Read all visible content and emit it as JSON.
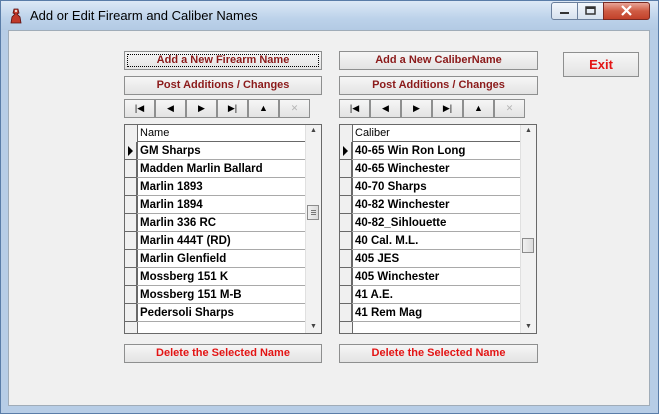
{
  "window": {
    "title": "Add or Edit Firearm and Caliber Names",
    "minimize_glyph": "▁",
    "maximize_glyph": "□",
    "close_glyph": "✕"
  },
  "left": {
    "add_label": "Add a New Firearm Name",
    "post_label": "Post Additions / Changes",
    "delete_label": "Delete the Selected Name",
    "column_header": "Name",
    "rows": [
      "GM Sharps",
      "Madden Marlin Ballard",
      "Marlin 1893",
      "Marlin 1894",
      "Marlin 336 RC",
      "Marlin 444T (RD)",
      "Marlin Glenfield",
      "Mossberg 151 K",
      "Mossberg 151 M-B",
      "Pedersoli Sharps"
    ],
    "current_row": 0,
    "scroll_fraction": 0.4
  },
  "right": {
    "add_label": "Add a New CaliberName",
    "post_label": "Post Additions / Changes",
    "delete_label": "Delete the Selected Name",
    "column_header": "Caliber",
    "rows": [
      "40-65 Win Ron Long",
      "40-65 Winchester",
      "40-70 Sharps",
      "40-82 Winchester",
      "40-82_Sihlouette",
      "40 Cal. M.L.",
      "405 JES",
      "405 Winchester",
      "41 A.E.",
      "41 Rem Mag"
    ],
    "current_row": 0,
    "scroll_fraction": 0.6
  },
  "nav_buttons": [
    {
      "name": "first",
      "glyph": "|◀",
      "enabled": true
    },
    {
      "name": "prior",
      "glyph": "◀",
      "enabled": true
    },
    {
      "name": "next",
      "glyph": "▶",
      "enabled": true
    },
    {
      "name": "last",
      "glyph": "▶|",
      "enabled": true
    },
    {
      "name": "edit",
      "glyph": "▲",
      "enabled": true
    },
    {
      "name": "cancel",
      "glyph": "✕",
      "enabled": false
    }
  ],
  "exit_label": "Exit",
  "colors": {
    "button_text": "#8b1a1a",
    "accent_red": "#e31414",
    "window_frame": "#b7cde6"
  }
}
